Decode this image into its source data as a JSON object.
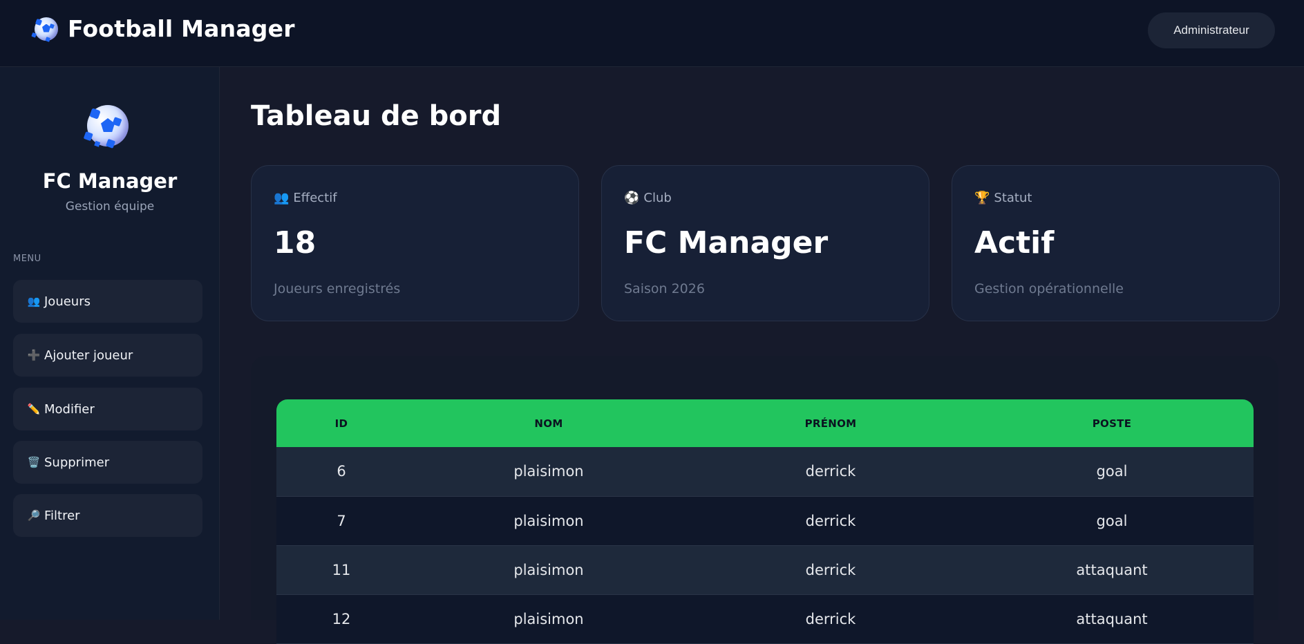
{
  "header": {
    "app_title": "Football Manager",
    "logo_icon": "soccer-ball-icon",
    "user_label": "Administrateur"
  },
  "sidebar": {
    "logo_icon": "soccer-ball-icon",
    "title": "FC Manager",
    "subtitle": "Gestion équipe",
    "menu_label": "MENU",
    "items": [
      {
        "icon": "👥",
        "icon_name": "users-icon",
        "label": "Joueurs"
      },
      {
        "icon": "➕",
        "icon_name": "plus-icon",
        "label": "Ajouter joueur"
      },
      {
        "icon": "✏️",
        "icon_name": "pencil-icon",
        "label": "Modifier"
      },
      {
        "icon": "🗑️",
        "icon_name": "trash-icon",
        "label": "Supprimer"
      },
      {
        "icon": "🔎",
        "icon_name": "magnifier-icon",
        "label": "Filtrer"
      }
    ]
  },
  "main": {
    "title": "Tableau de bord",
    "cards": [
      {
        "icon": "👥",
        "icon_name": "users-icon",
        "label": "Effectif",
        "value": "18",
        "desc": "Joueurs enregistrés"
      },
      {
        "icon": "⚽",
        "icon_name": "soccer-ball-icon",
        "label": "Club",
        "value": "FC Manager",
        "desc": "Saison 2026"
      },
      {
        "icon": "🏆",
        "icon_name": "trophy-icon",
        "label": "Statut",
        "value": "Actif",
        "desc": "Gestion opérationnelle"
      }
    ],
    "table": {
      "columns": [
        "ID",
        "NOM",
        "PRÉNOM",
        "POSTE"
      ],
      "rows": [
        [
          "6",
          "plaisimon",
          "derrick",
          "goal"
        ],
        [
          "7",
          "plaisimon",
          "derrick",
          "goal"
        ],
        [
          "11",
          "plaisimon",
          "derrick",
          "attaquant"
        ],
        [
          "12",
          "plaisimon",
          "derrick",
          "attaquant"
        ]
      ]
    }
  },
  "colors": {
    "accent_green": "#22c55e",
    "background": "#161a2b",
    "card": "#172036"
  }
}
